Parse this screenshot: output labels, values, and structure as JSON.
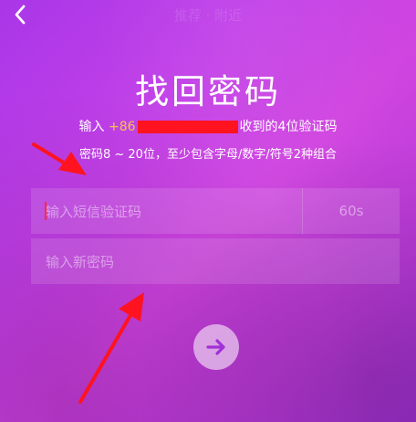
{
  "header": {
    "faint_title": "推荐 · 附近"
  },
  "page": {
    "title": "找回密码",
    "sms_prefix": "输入 ",
    "phone_visible": "+86",
    "sms_suffix": "收到的4位验证码",
    "password_rule": "密码8 ~ 20位，至少包含字母/数字/符号2种组合"
  },
  "form": {
    "code_placeholder": "输入短信验证码",
    "countdown_label": "60s",
    "password_placeholder": "输入新密码"
  },
  "icons": {
    "back": "chevron-left-icon",
    "submit": "arrow-right-icon"
  },
  "colors": {
    "phone_highlight": "#f6c347",
    "annotation_red": "#ff1320"
  }
}
